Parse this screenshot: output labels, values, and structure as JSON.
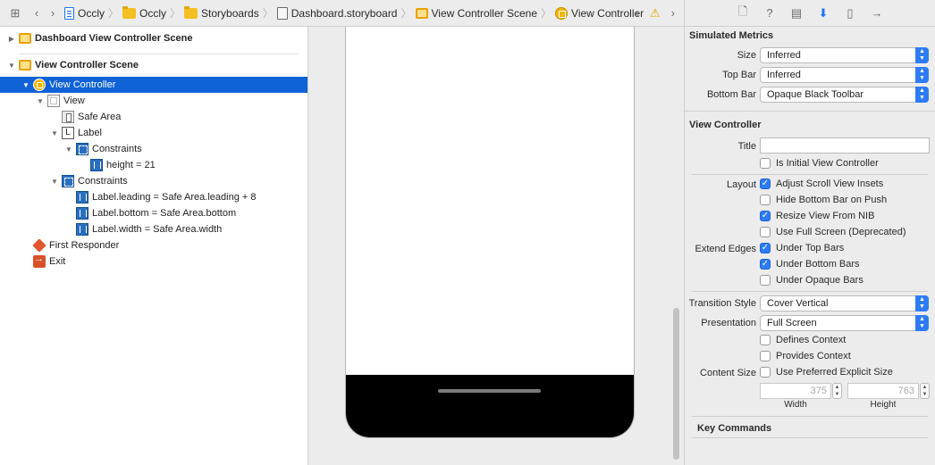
{
  "jumpbar": {
    "crumbs": [
      "Occly",
      "Occly",
      "Storyboards",
      "Dashboard.storyboard",
      "View Controller Scene",
      "View Controller"
    ]
  },
  "outline": {
    "rows": [
      {
        "label": "Dashboard View Controller Scene"
      },
      {
        "label": "View Controller Scene"
      },
      {
        "label": "View Controller"
      },
      {
        "label": "View"
      },
      {
        "label": "Safe Area"
      },
      {
        "label": "Label"
      },
      {
        "label": "Constraints"
      },
      {
        "label": "height = 21"
      },
      {
        "label": "Constraints"
      },
      {
        "label": "Label.leading = Safe Area.leading + 8"
      },
      {
        "label": "Label.bottom = Safe Area.bottom"
      },
      {
        "label": "Label.width = Safe Area.width"
      },
      {
        "label": "First Responder"
      },
      {
        "label": "Exit"
      }
    ]
  },
  "inspector": {
    "simulated_metrics": {
      "title": "Simulated Metrics",
      "size_label": "Size",
      "size_value": "Inferred",
      "topbar_label": "Top Bar",
      "topbar_value": "Inferred",
      "bottombar_label": "Bottom Bar",
      "bottombar_value": "Opaque Black Toolbar"
    },
    "view_controller": {
      "title": "View Controller",
      "title_label": "Title",
      "is_initial": "Is Initial View Controller",
      "layout_label": "Layout",
      "adjust_scroll": "Adjust Scroll View Insets",
      "hide_bottom_bar": "Hide Bottom Bar on Push",
      "resize_view": "Resize View From NIB",
      "full_screen": "Use Full Screen (Deprecated)",
      "extend_edges_label": "Extend Edges",
      "under_top": "Under Top Bars",
      "under_bottom": "Under Bottom Bars",
      "under_opaque": "Under Opaque Bars",
      "transition_label": "Transition Style",
      "transition_value": "Cover Vertical",
      "presentation_label": "Presentation",
      "presentation_value": "Full Screen",
      "defines_context": "Defines Context",
      "provides_context": "Provides Context",
      "content_size_label": "Content Size",
      "preferred_size": "Use Preferred Explicit Size",
      "width_value": "375",
      "height_value": "763",
      "width_caption": "Width",
      "height_caption": "Height"
    },
    "key_commands": {
      "title": "Key Commands"
    }
  }
}
